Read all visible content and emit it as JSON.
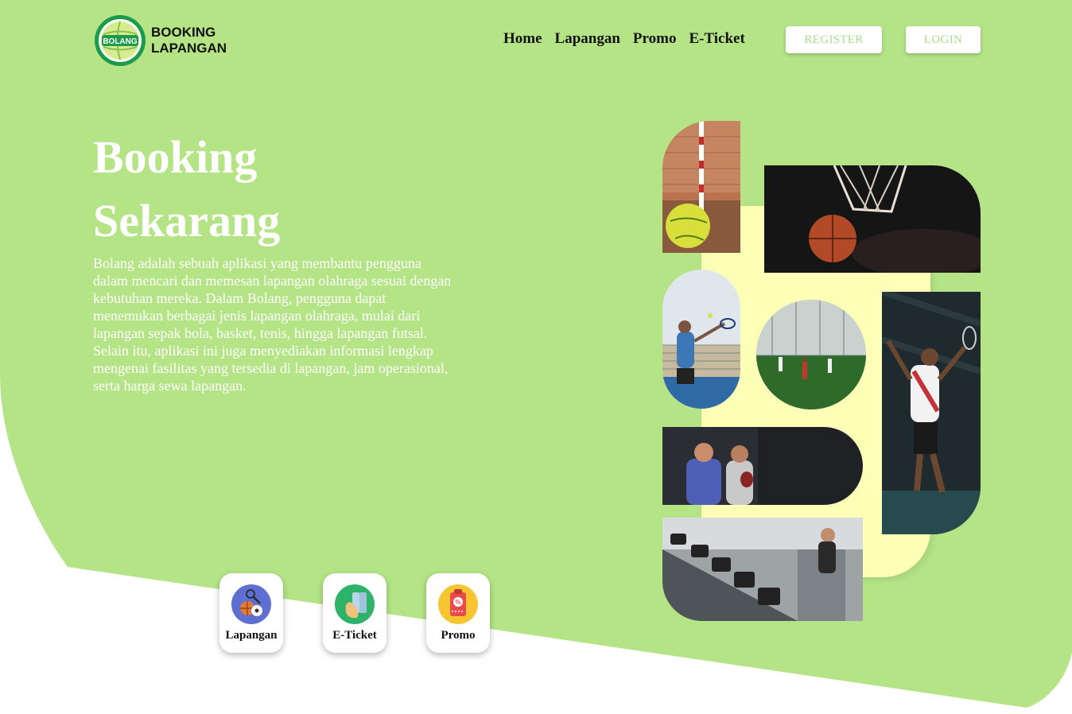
{
  "brand": {
    "badge_text": "BOLANG",
    "name_line1": "BOOKING",
    "name_line2": "LAPANGAN"
  },
  "nav": {
    "items": [
      {
        "label": "Home"
      },
      {
        "label": "Lapangan"
      },
      {
        "label": "Promo"
      },
      {
        "label": "E-Ticket"
      }
    ]
  },
  "auth": {
    "register_label": "REGISTER",
    "login_label": "LOGIN"
  },
  "hero": {
    "title_line1": "Booking",
    "title_line2": "Sekarang",
    "description": "Bolang adalah sebuah aplikasi yang membantu pengguna dalam mencari dan memesan lapangan olahraga sesuai dengan kebutuhan mereka. Dalam Bolang, pengguna dapat menemukan berbagai jenis lapangan olahraga, mulai dari lapangan sepak bola, basket, tenis, hingga lapangan futsal. Selain itu, aplikasi ini juga menyediakan informasi lengkap mengenai fasilitas yang tersedia di lapangan, jam operasional, serta harga sewa lapangan."
  },
  "quick_actions": [
    {
      "label": "Lapangan",
      "icon": "sports-balls-icon",
      "color": "#5d6fd1"
    },
    {
      "label": "E-Ticket",
      "icon": "ticket-icon",
      "color": "#2fb36a"
    },
    {
      "label": "Promo",
      "icon": "promo-tag-icon",
      "color": "#f7c531"
    }
  ],
  "colors": {
    "primary_green": "#b5e487",
    "accent_text_green": "#a9dd8b",
    "collage_yellow": "#fdffb6"
  },
  "collage_photos": [
    {
      "subject": "futsal-ball"
    },
    {
      "subject": "basketball-hoop"
    },
    {
      "subject": "tennis-player"
    },
    {
      "subject": "soccer-field"
    },
    {
      "subject": "badminton-player"
    },
    {
      "subject": "table-tennis-coach"
    },
    {
      "subject": "gym-dumbbells"
    }
  ]
}
